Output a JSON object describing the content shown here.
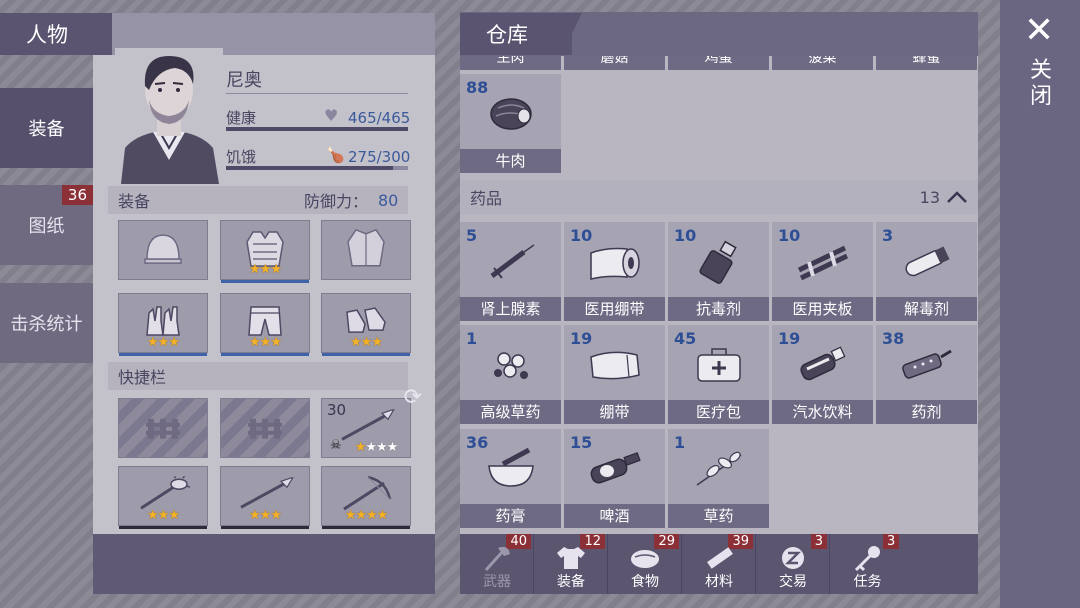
{
  "left_panel": {
    "title": "人物",
    "tabs": [
      {
        "label": "装备",
        "active": true
      },
      {
        "label": "图纸",
        "badge": "36"
      },
      {
        "label": "击杀统计"
      }
    ],
    "character": {
      "name": "尼奥",
      "health_label": "健康",
      "health_value": "465/465",
      "health_ratio": 1.0,
      "hunger_label": "饥饿",
      "hunger_value": "275/300",
      "hunger_ratio": 0.917
    },
    "equipment": {
      "label": "装备",
      "defense_label": "防御力：",
      "defense_value": "80",
      "slots": [
        {
          "icon": "hat-icon",
          "stars": 0
        },
        {
          "icon": "armor-vest-icon",
          "stars": 3
        },
        {
          "icon": "jacket-icon",
          "stars": 0
        },
        {
          "icon": "gloves-icon",
          "stars": 3
        },
        {
          "icon": "shorts-icon",
          "stars": 3
        },
        {
          "icon": "shoes-icon",
          "stars": 3
        }
      ]
    },
    "quickbar": {
      "label": "快捷栏",
      "slots": [
        {
          "locked": true
        },
        {
          "locked": true
        },
        {
          "icon": "spear-icon",
          "count": "30",
          "stars": 1,
          "max_stars": 4
        },
        {
          "icon": "spiked-club-icon",
          "stars": 3
        },
        {
          "icon": "spear-icon",
          "stars": 3
        },
        {
          "icon": "crossbow-icon",
          "stars": 4
        }
      ]
    }
  },
  "right_panel": {
    "title": "仓库",
    "partial_row_labels": [
      "生肉",
      "蘑菇",
      "鸡蛋",
      "菠菜",
      "蜂蜜"
    ],
    "food_items": [
      {
        "count": "88",
        "label": "牛肉",
        "icon": "beef-icon"
      }
    ],
    "medicine": {
      "label": "药品",
      "count": "13",
      "items": [
        {
          "count": "5",
          "label": "肾上腺素",
          "icon": "syringe-icon"
        },
        {
          "count": "10",
          "label": "医用绷带",
          "icon": "bandage-icon"
        },
        {
          "count": "10",
          "label": "抗毒剂",
          "icon": "vial-icon"
        },
        {
          "count": "10",
          "label": "医用夹板",
          "icon": "splint-icon"
        },
        {
          "count": "3",
          "label": "解毒剂",
          "icon": "test-tube-icon"
        },
        {
          "count": "1",
          "label": "高级草药",
          "icon": "herb-flower-icon"
        },
        {
          "count": "19",
          "label": "绷带",
          "icon": "rag-icon"
        },
        {
          "count": "45",
          "label": "医疗包",
          "icon": "medkit-icon"
        },
        {
          "count": "19",
          "label": "汽水饮料",
          "icon": "soda-bottle-icon"
        },
        {
          "count": "38",
          "label": "药剂",
          "icon": "ampoule-icon"
        },
        {
          "count": "36",
          "label": "药膏",
          "icon": "mortar-icon"
        },
        {
          "count": "15",
          "label": "啤酒",
          "icon": "beer-bottle-icon"
        },
        {
          "count": "1",
          "label": "草药",
          "icon": "herb-icon"
        }
      ]
    },
    "bottom_tabs": [
      {
        "label": "武器",
        "badge": "40",
        "icon": "axe-icon",
        "dim": true
      },
      {
        "label": "装备",
        "badge": "12",
        "icon": "shirt-icon"
      },
      {
        "label": "食物",
        "badge": "29",
        "icon": "steak-icon"
      },
      {
        "label": "材料",
        "badge": "39",
        "icon": "plank-icon"
      },
      {
        "label": "交易",
        "badge": "3",
        "icon": "coin-icon"
      },
      {
        "label": "任务",
        "badge": "3",
        "icon": "key-icon"
      }
    ]
  },
  "close": {
    "label": "关闭",
    "glyph": "✕"
  },
  "colors": {
    "star": "#f3b229",
    "badge": "#8c3038",
    "count": "#2e4f95"
  }
}
